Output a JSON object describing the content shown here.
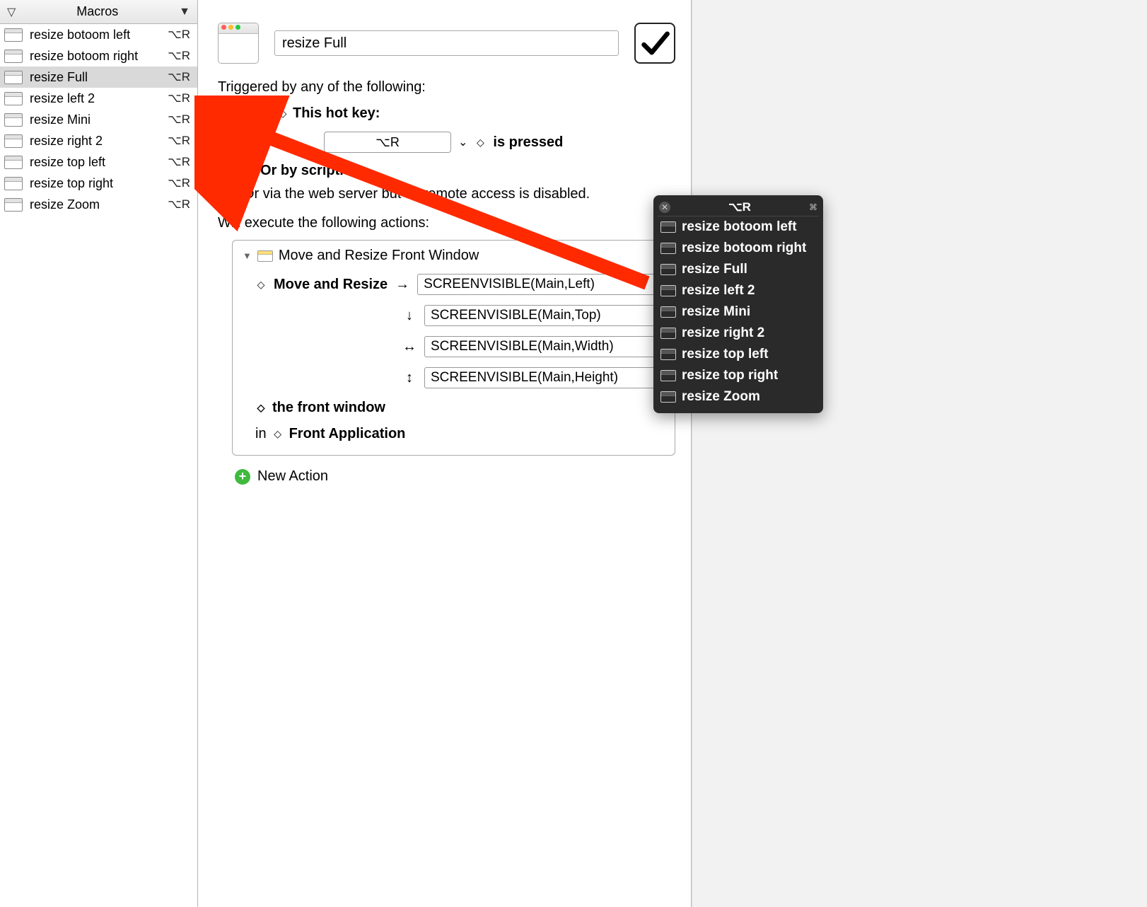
{
  "sidebar": {
    "title": "Macros",
    "items": [
      {
        "name": "resize botoom left",
        "shortcut": "⌥R"
      },
      {
        "name": "resize botoom right",
        "shortcut": "⌥R"
      },
      {
        "name": "resize Full",
        "shortcut": "⌥R"
      },
      {
        "name": "resize left 2",
        "shortcut": "⌥R"
      },
      {
        "name": "resize Mini",
        "shortcut": "⌥R"
      },
      {
        "name": "resize right 2",
        "shortcut": "⌥R"
      },
      {
        "name": "resize top left",
        "shortcut": "⌥R"
      },
      {
        "name": "resize top right",
        "shortcut": "⌥R"
      },
      {
        "name": "resize Zoom",
        "shortcut": "⌥R"
      }
    ],
    "selected_index": 2
  },
  "editor": {
    "macro_name": "resize Full",
    "triggered_by_label": "Triggered by any of the following:",
    "hotkey_title": "This hot key:",
    "hotkey_value": "⌥R",
    "is_pressed_label": "is pressed",
    "or_script_label": "Or by script.",
    "or_via_label": "Or via the web server but all remote access is disabled.",
    "execute_label": "Will execute the following actions:",
    "action_title": "Move and Resize Front Window",
    "move_label": "Move and Resize",
    "left_value": "SCREENVISIBLE(Main,Left)",
    "top_value": "SCREENVISIBLE(Main,Top)",
    "width_value": "SCREENVISIBLE(Main,Width)",
    "height_value": "SCREENVISIBLE(Main,Height)",
    "front_window_label": "the front window",
    "in_label": "in",
    "front_app_label": "Front Application",
    "new_action_label": "New Action"
  },
  "palette": {
    "title": "⌥R",
    "items": [
      "resize botoom left",
      "resize botoom right",
      "resize Full",
      "resize left 2",
      "resize Mini",
      "resize right 2",
      "resize top left",
      "resize top right",
      "resize Zoom"
    ]
  },
  "glyphs": {
    "sort_open": "▽",
    "sort_solid": "▼",
    "stepper": "◇",
    "arrow_right": "→",
    "arrow_down": "↓",
    "arrow_lr": "↔",
    "arrow_ud": "↕",
    "dropdown": "⌄",
    "tri": "▼",
    "gear": "⌘"
  }
}
